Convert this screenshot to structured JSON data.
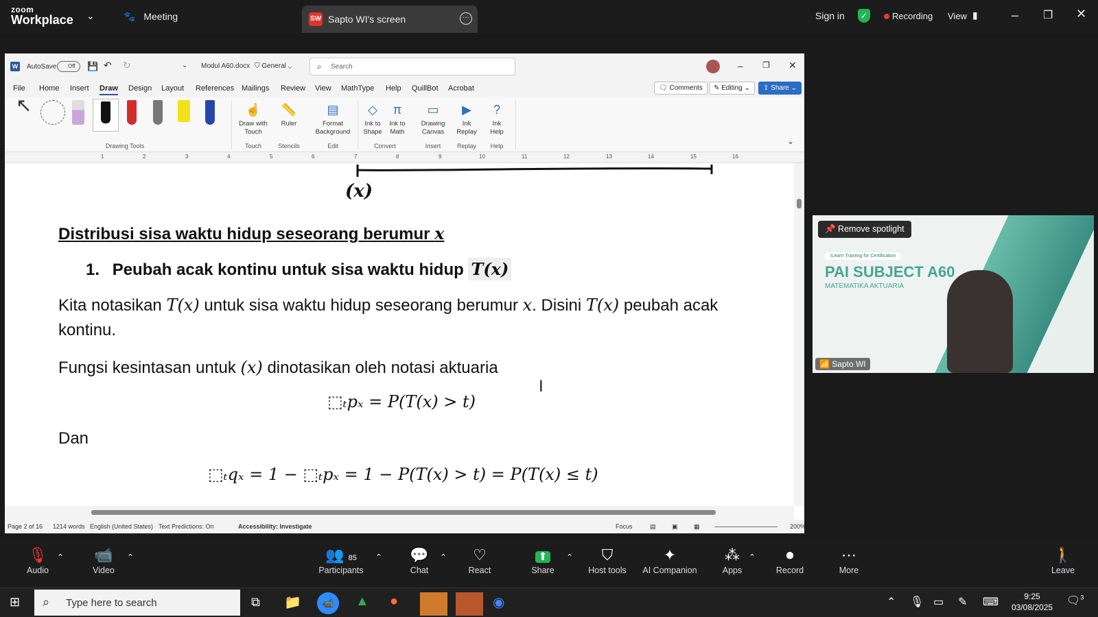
{
  "zoom": {
    "logo_top": "zoom",
    "logo_bottom": "Workplace",
    "meeting_label": "Meeting",
    "share_tab_badge": "SW",
    "share_tab_title": "Sapto WI's screen",
    "sign_in": "Sign in",
    "recording": "Recording",
    "view": "View"
  },
  "word": {
    "autosave": "AutoSave",
    "autosave_state": "Off",
    "doc_name": "Modul A60.docx",
    "sensitivity": "General",
    "search_placeholder": "Search",
    "menu": [
      "File",
      "Home",
      "Insert",
      "Draw",
      "Design",
      "Layout",
      "References",
      "Mailings",
      "Review",
      "View",
      "MathType",
      "Help",
      "QuillBot",
      "Acrobat"
    ],
    "comments": "Comments",
    "editing": "Editing",
    "share": "Share",
    "ribbon": {
      "draw_with_touch": "Draw with Touch",
      "ruler": "Ruler",
      "format_background": "Format Background",
      "ink_to_shape": "Ink to Shape",
      "ink_to_math": "Ink to Math",
      "drawing_canvas": "Drawing Canvas",
      "ink_replay": "Ink Replay",
      "ink_help": "Ink Help",
      "groups": [
        "Drawing Tools",
        "Touch",
        "Stencils",
        "Edit",
        "Convert",
        "Insert",
        "Replay",
        "Help"
      ]
    },
    "ruler_numbers": [
      "1",
      "2",
      "3",
      "4",
      "5",
      "6",
      "7",
      "8",
      "9",
      "10",
      "11",
      "12",
      "13",
      "14",
      "15",
      "16"
    ],
    "doc": {
      "handwritten": "(x)",
      "heading": "Distribusi sisa waktu hidup seseorang berumur",
      "heading_var": "x",
      "item_number": "1.",
      "item_text": "Peubah acak kontinu untuk sisa waktu hidup",
      "item_math": "T(x)",
      "para1_a": "Kita notasikan",
      "para1_m1": "T(x)",
      "para1_b": "untuk sisa waktu hidup seseorang berumur",
      "para1_m2": "x",
      "para1_c": ". Disini",
      "para1_m3": "T(x)",
      "para1_d": "peubah acak",
      "para1_e": "kontinu.",
      "para2_a": "Fungsi kesintasan untuk",
      "para2_m": "(x)",
      "para2_b": "dinotasikan oleh notasi aktuaria",
      "eq1": "⬚ₜpₓ = P(T(x) > t)",
      "dan": "Dan",
      "eq2": "⬚ₜqₓ = 1 − ⬚ₜpₓ = 1 − P(T(x) > t) = P(T(x) ≤ t)"
    },
    "status": {
      "page": "Page 2 of 16",
      "words": "1214 words",
      "language": "English (United States)",
      "text_predictions": "Text Predictions: On",
      "accessibility": "Accessibility: Investigate",
      "focus": "Focus",
      "zoom": "200%"
    }
  },
  "video": {
    "remove_spotlight": "Remove spotlight",
    "banner_small": "iLearn Training for Certification",
    "banner_title": "PAI SUBJECT A60",
    "banner_sub": "MATEMATIKA AKTUARIA",
    "participant": "Sapto WI"
  },
  "toolbar": {
    "audio": "Audio",
    "video": "Video",
    "participants": "Participants",
    "participant_count": "85",
    "chat": "Chat",
    "react": "React",
    "share": "Share",
    "host_tools": "Host tools",
    "ai_companion": "AI Companion",
    "apps": "Apps",
    "record": "Record",
    "more": "More",
    "leave": "Leave"
  },
  "taskbar": {
    "search_placeholder": "Type here to search",
    "time": "9:25",
    "date": "03/08/2025",
    "notif_count": "3"
  }
}
